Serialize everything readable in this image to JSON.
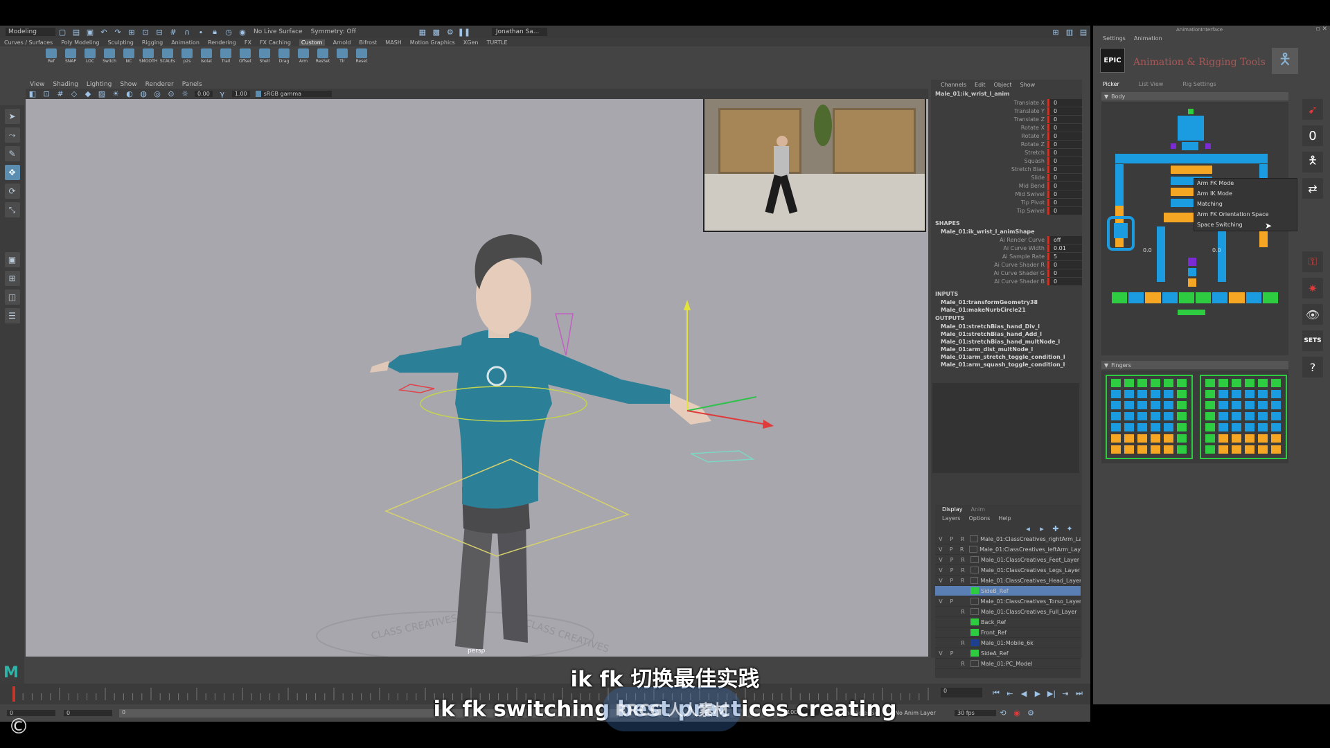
{
  "app": {
    "mode": "Modeling",
    "live_surface": "No Live Surface",
    "symmetry": "Symmetry: Off",
    "user": "Jonathan Sa...",
    "accent": "#5a8db0"
  },
  "shelf_tabs": [
    "Curves / Surfaces",
    "Poly Modeling",
    "Sculpting",
    "Rigging",
    "Animation",
    "Rendering",
    "FX",
    "FX Caching",
    "Custom",
    "Arnold",
    "Bifrost",
    "MASH",
    "Motion Graphics",
    "XGen",
    "TURTLE"
  ],
  "shelf_active": "Custom",
  "shelf_icons": [
    "Ref",
    "SNAP",
    "LOC",
    "Switch",
    "NC",
    "SMOOTH",
    "SCALEs",
    "p2s",
    "Isolat",
    "Trail",
    "Offset",
    "Shell",
    "Drag",
    "Arm",
    "ResSet",
    "Tlr",
    "Reset"
  ],
  "viewport_menu": [
    "View",
    "Shading",
    "Lighting",
    "Show",
    "Renderer",
    "Panels"
  ],
  "viewport_fields": {
    "a": "0.00",
    "b": "1.00",
    "color": "sRGB gamma"
  },
  "camera_label": "persp",
  "ground_text": "CLASS CREATIVES",
  "channelbox": {
    "menu": [
      "Channels",
      "Edit",
      "Object",
      "Show"
    ],
    "object": "Male_01:ik_wrist_l_anim",
    "channels": [
      {
        "label": "Translate X",
        "value": "0"
      },
      {
        "label": "Translate Y",
        "value": "0"
      },
      {
        "label": "Translate Z",
        "value": "0"
      },
      {
        "label": "Rotate X",
        "value": "0"
      },
      {
        "label": "Rotate Y",
        "value": "0"
      },
      {
        "label": "Rotate Z",
        "value": "0"
      },
      {
        "label": "Stretch",
        "value": "0"
      },
      {
        "label": "Squash",
        "value": "0"
      },
      {
        "label": "Stretch Bias",
        "value": "0"
      },
      {
        "label": "Slide",
        "value": "0"
      },
      {
        "label": "Mid Bend",
        "value": "0"
      },
      {
        "label": "Mid Swivel",
        "value": "0"
      },
      {
        "label": "Tip Pivot",
        "value": "0"
      },
      {
        "label": "Tip Swivel",
        "value": "0"
      }
    ],
    "shapes_title": "SHAPES",
    "shape_node": "Male_01:ik_wrist_l_animShape",
    "shape_channels": [
      {
        "label": "Ai Render Curve",
        "value": "off"
      },
      {
        "label": "Ai Curve Width",
        "value": "0.01"
      },
      {
        "label": "Ai Sample Rate",
        "value": "5"
      },
      {
        "label": "Ai Curve Shader R",
        "value": "0"
      },
      {
        "label": "Ai Curve Shader G",
        "value": "0"
      },
      {
        "label": "Ai Curve Shader B",
        "value": "0"
      }
    ],
    "inputs_title": "INPUTS",
    "inputs": [
      "Male_01:transformGeometry38",
      "Male_01:makeNurbCircle21"
    ],
    "outputs_title": "OUTPUTS",
    "outputs": [
      "Male_01:stretchBias_hand_Div_l",
      "Male_01:stretchBias_hand_Add_l",
      "Male_01:stretchBias_hand_multNode_l",
      "Male_01:arm_dist_multNode_l",
      "Male_01:arm_stretch_toggle_condition_l",
      "Male_01:arm_squash_toggle_condition_l"
    ]
  },
  "layers": {
    "tabs": [
      "Display",
      "Anim"
    ],
    "menu": [
      "Layers",
      "Options",
      "Help"
    ],
    "items": [
      {
        "v": "V",
        "p": "P",
        "r": "R",
        "color": "",
        "name": "Male_01:ClassCreatives_rightArm_La",
        "selected": false
      },
      {
        "v": "V",
        "p": "P",
        "r": "R",
        "color": "",
        "name": "Male_01:ClassCreatives_leftArm_Laye",
        "selected": false
      },
      {
        "v": "V",
        "p": "P",
        "r": "R",
        "color": "",
        "name": "Male_01:ClassCreatives_Feet_Layer",
        "selected": false
      },
      {
        "v": "V",
        "p": "P",
        "r": "R",
        "color": "",
        "name": "Male_01:ClassCreatives_Legs_Layer",
        "selected": false
      },
      {
        "v": "V",
        "p": "P",
        "r": "R",
        "color": "",
        "name": "Male_01:ClassCreatives_Head_Layer",
        "selected": false
      },
      {
        "v": "",
        "p": "",
        "r": "",
        "color": "#2ecc40",
        "name": "SideB_Ref",
        "selected": true
      },
      {
        "v": "V",
        "p": "P",
        "r": "",
        "color": "",
        "name": "Male_01:ClassCreatives_Torso_Layer",
        "selected": false
      },
      {
        "v": "",
        "p": "",
        "r": "R",
        "color": "",
        "name": "Male_01:ClassCreatives_Full_Layer",
        "selected": false
      },
      {
        "v": "",
        "p": "",
        "r": "",
        "color": "#2ecc40",
        "name": "Back_Ref",
        "selected": false
      },
      {
        "v": "",
        "p": "",
        "r": "",
        "color": "#2ecc40",
        "name": "Front_Ref",
        "selected": false
      },
      {
        "v": "",
        "p": "",
        "r": "R",
        "color": "#1f3f8f",
        "name": "Male_01:Mobile_6k",
        "selected": false
      },
      {
        "v": "V",
        "p": "P",
        "r": "",
        "color": "#2ecc40",
        "name": "SideA_Ref",
        "selected": false
      },
      {
        "v": "",
        "p": "",
        "r": "R",
        "color": "",
        "name": "Male_01:PC_Model",
        "selected": false
      }
    ]
  },
  "range": {
    "start": "0",
    "inner_start": "0",
    "field": "0",
    "end": "100",
    "current": "0",
    "char_set": "No Character Set",
    "anim_layer": "No Anim Layer",
    "fps": "30 fps"
  },
  "picker": {
    "title": "AnimationInterface",
    "menu": [
      "Settings",
      "Animation"
    ],
    "logo": "EPIC",
    "heading": "Animation & Rigging Tools",
    "tabs": [
      "Picker",
      "List View",
      "Rig Settings"
    ],
    "body_section": "Body",
    "fingers_section": "Fingers",
    "value_a": "0.0",
    "value_b": "0.0",
    "right_zero": "0",
    "sets_label": "SETS",
    "help_label": "?",
    "context_menu": [
      "Arm FK Mode",
      "Arm IK Mode",
      "Matching",
      "Arm FK Orientation Space",
      "Space Switching"
    ]
  },
  "subtitles": {
    "chinese": "ik fk 切换最佳实践",
    "english": "ik fk switching best practices creating"
  },
  "watermark": "RRCG 人人素材",
  "copyright": "©"
}
